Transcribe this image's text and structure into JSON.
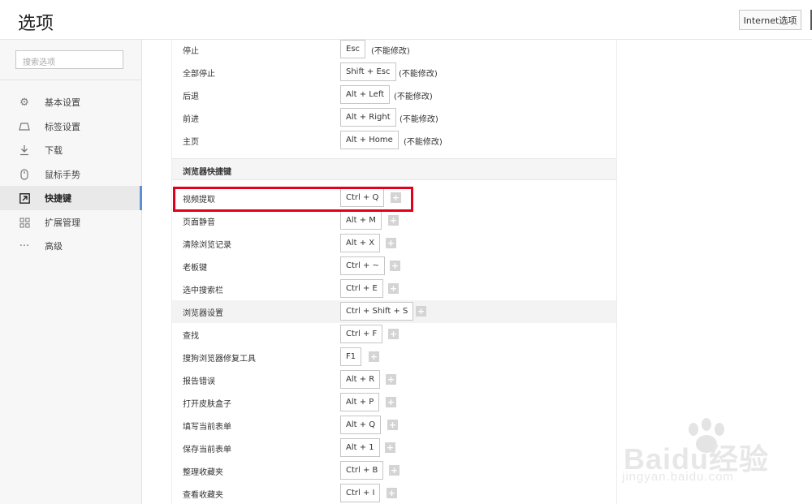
{
  "header": {
    "title": "选项",
    "internet_button": "Internet选项"
  },
  "sidebar": {
    "search_placeholder": "搜索选项",
    "items": [
      {
        "label": "基本设置",
        "icon": "gear-icon",
        "active": false
      },
      {
        "label": "标签设置",
        "icon": "tab-icon",
        "active": false
      },
      {
        "label": "下载",
        "icon": "download-icon",
        "active": false
      },
      {
        "label": "鼠标手势",
        "icon": "mouse-icon",
        "active": false
      },
      {
        "label": "快捷键",
        "icon": "shortcut-icon",
        "active": true
      },
      {
        "label": "扩展管理",
        "icon": "extensions-icon",
        "active": false
      },
      {
        "label": "高级",
        "icon": "more-icon",
        "active": false
      }
    ]
  },
  "fixed_shortcuts": [
    {
      "name": "停止",
      "key": "Esc",
      "note": "(不能修改)"
    },
    {
      "name": "全部停止",
      "key": "Shift + Esc",
      "note": "(不能修改)"
    },
    {
      "name": "后退",
      "key": "Alt + Left",
      "note": "(不能修改)"
    },
    {
      "name": "前进",
      "key": "Alt + Right",
      "note": "(不能修改)"
    },
    {
      "name": "主页",
      "key": "Alt + Home",
      "note": "(不能修改)"
    }
  ],
  "section_title": "浏览器快捷键",
  "browser_shortcuts": [
    {
      "name": "视频提取",
      "key": "Ctrl + Q",
      "highlighted_box": true
    },
    {
      "name": "页面静音",
      "key": "Alt + M"
    },
    {
      "name": "清除浏览记录",
      "key": "Alt + X"
    },
    {
      "name": "老板键",
      "key": "Ctrl + ~"
    },
    {
      "name": "选中搜索栏",
      "key": "Ctrl + E"
    },
    {
      "name": "浏览器设置",
      "key": "Ctrl + Shift + S",
      "hover": true
    },
    {
      "name": "查找",
      "key": "Ctrl + F"
    },
    {
      "name": "搜狗浏览器修复工具",
      "key": "F1"
    },
    {
      "name": "报告错误",
      "key": "Alt + R"
    },
    {
      "name": "打开皮肤盒子",
      "key": "Alt + P"
    },
    {
      "name": "填写当前表单",
      "key": "Alt + Q"
    },
    {
      "name": "保存当前表单",
      "key": "Alt + 1"
    },
    {
      "name": "整理收藏夹",
      "key": "Ctrl + B"
    },
    {
      "name": "查看收藏夹",
      "key": "Ctrl + I"
    }
  ],
  "add_button_label": "+",
  "watermark": {
    "line1": "Bai",
    "line1b": "du",
    "line1c": "经验",
    "line2": "jingyan.baidu.com"
  },
  "colors": {
    "accent": "#5a8fd6",
    "highlight_box": "#e3001b"
  }
}
